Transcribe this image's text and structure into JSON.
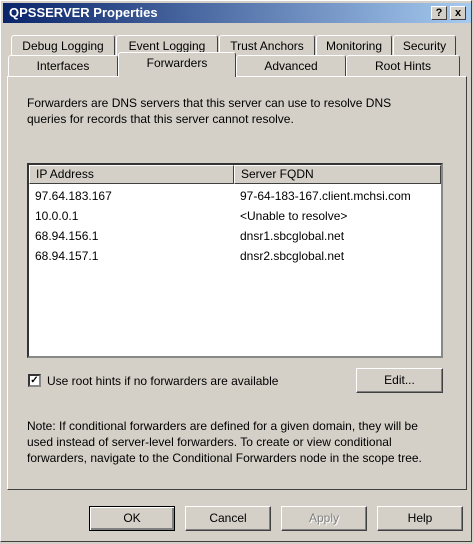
{
  "window": {
    "title": "QPSSERVER Properties",
    "help_btn": "?",
    "close_btn": "x"
  },
  "tabs_back": [
    {
      "label": "Debug Logging"
    },
    {
      "label": "Event Logging"
    },
    {
      "label": "Trust Anchors"
    },
    {
      "label": "Monitoring"
    },
    {
      "label": "Security"
    }
  ],
  "tabs_front": [
    {
      "label": "Interfaces"
    },
    {
      "label": "Forwarders"
    },
    {
      "label": "Advanced"
    },
    {
      "label": "Root Hints"
    }
  ],
  "forwarders": {
    "description_line1": "Forwarders are DNS servers that this server can use to resolve DNS",
    "description_line2": "queries for records that this server cannot resolve.",
    "columns": [
      "IP Address",
      "Server FQDN"
    ],
    "rows": [
      [
        "97.64.183.167",
        "97-64-183-167.client.mchsi.com"
      ],
      [
        "10.0.0.1",
        "<Unable to resolve>"
      ],
      [
        "68.94.156.1",
        "dnsr1.sbcglobal.net"
      ],
      [
        "68.94.157.1",
        "dnsr2.sbcglobal.net"
      ]
    ],
    "use_root_hints_label": "Use root hints if no forwarders are available",
    "use_root_hints_checked": true,
    "edit_button": "Edit...",
    "note_line1": "Note: If conditional forwarders are defined for a given domain, they will be",
    "note_line2": "used instead of server-level forwarders.  To create or view conditional",
    "note_line3": "forwarders, navigate to the Conditional Forwarders node in the scope tree."
  },
  "buttons": {
    "ok": "OK",
    "cancel": "Cancel",
    "apply": "Apply",
    "help": "Help"
  }
}
